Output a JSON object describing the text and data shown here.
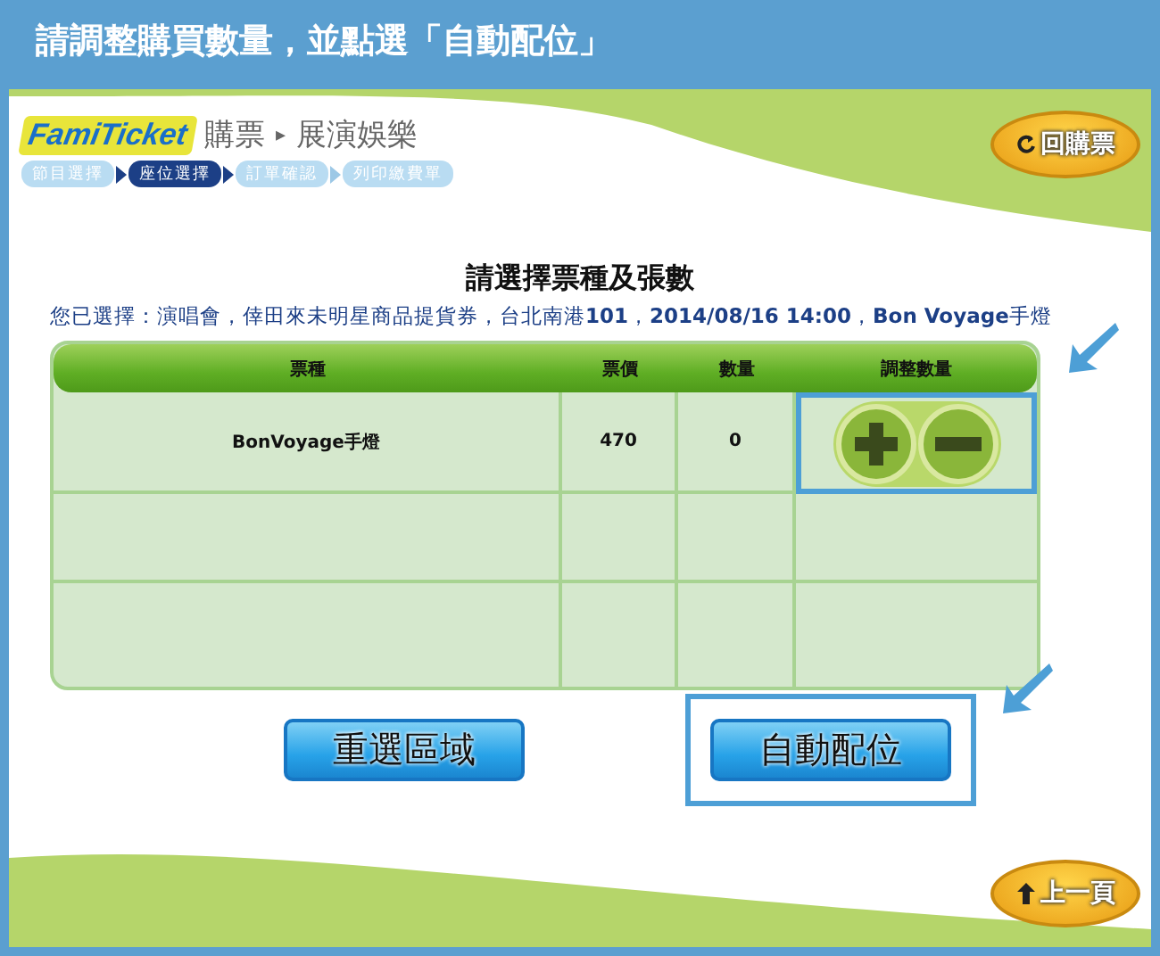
{
  "window": {
    "title": "請調整購買數量，並點選「自動配位」"
  },
  "logo": {
    "part_1": "Fami",
    "part_2": "Ticket"
  },
  "breadcrumb": {
    "section": "購票",
    "separator": "▸",
    "page": "展演娛樂"
  },
  "steps": [
    {
      "label": "節目選擇",
      "selected": false
    },
    {
      "label": "座位選擇",
      "selected": true
    },
    {
      "label": "訂單確認",
      "selected": false
    },
    {
      "label": "列印繳費單",
      "selected": false
    }
  ],
  "back_to_purchase_button": {
    "label": "回購票"
  },
  "heading": "請選擇票種及張數",
  "selection_summary": "您已選擇：演唱會，倖田來未明星商品提貨券，台北南港**101**，**2014/08/16 14:00**，**Bon Voyage**手燈",
  "table": {
    "columns": [
      {
        "label": "票種",
        "highlighted": false
      },
      {
        "label": "票價",
        "highlighted": false
      },
      {
        "label": "數量",
        "highlighted": false
      },
      {
        "label": "調整數量",
        "highlighted": true
      }
    ],
    "rows": [
      {
        "cells": [
          "BonVoyage手燈",
          "470",
          "0"
        ]
      }
    ]
  },
  "buttons": [
    {
      "label": "重選區域",
      "highlighted": false
    },
    {
      "label": "自動配位",
      "highlighted": true
    }
  ],
  "prev_page_button": {
    "label": "上一頁"
  }
}
